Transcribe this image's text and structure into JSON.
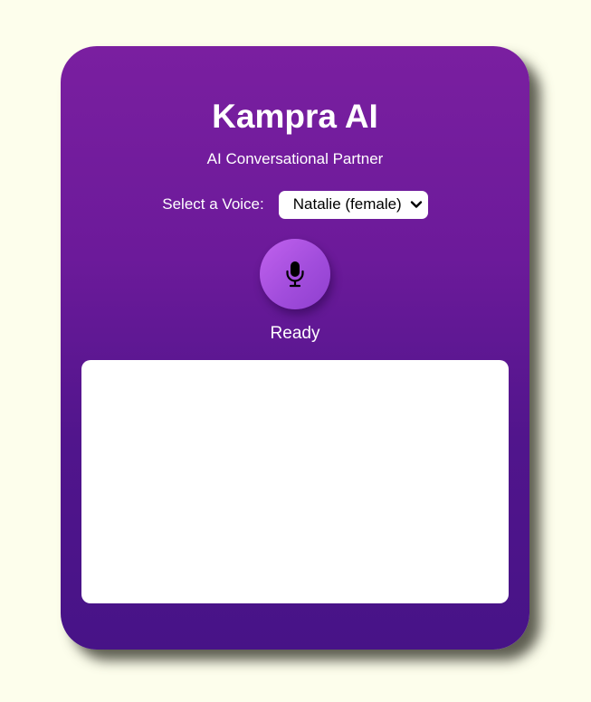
{
  "app": {
    "title": "Kampra AI",
    "subtitle": "AI Conversational Partner"
  },
  "voice": {
    "label": "Select a Voice:",
    "selected": "Natalie (female)"
  },
  "mic": {
    "icon": "microphone-icon"
  },
  "status": {
    "text": "Ready"
  },
  "colors": {
    "background": "#fdfeec",
    "card_top": "#7a1fa0",
    "card_bottom": "#471387",
    "mic_button": "#b055e6",
    "text": "#ffffff"
  }
}
